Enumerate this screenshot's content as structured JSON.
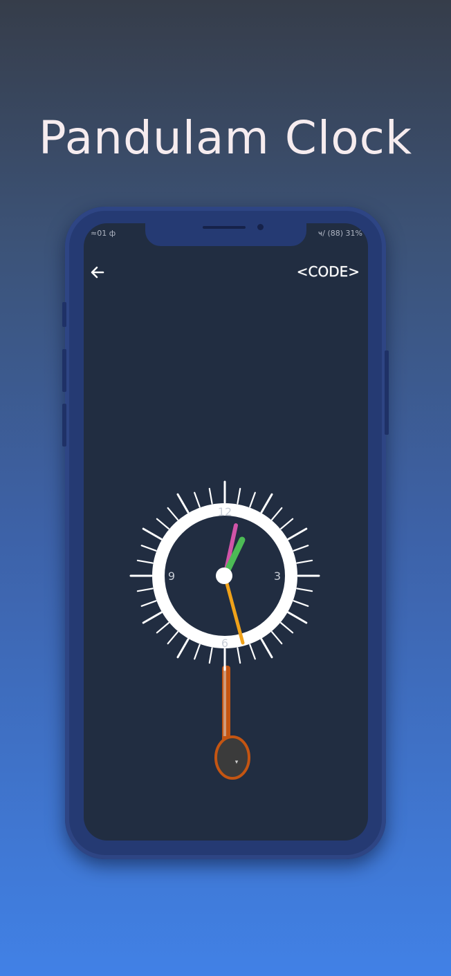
{
  "promo": {
    "title": "Pandulam Clock"
  },
  "status_bar": {
    "left": "≈01 ф",
    "right": "ҹ/ (88) 31%"
  },
  "toolbar": {
    "back_icon": "arrow-left-icon",
    "code_label": "<CODE>"
  },
  "clock": {
    "numerals": {
      "twelve": "12",
      "three": "3",
      "six": "6",
      "nine": "9"
    },
    "hands": {
      "hour_color": "#d054a8",
      "minute_color": "#4cbb55",
      "second_color": "#f0a21a"
    },
    "pendulum_color": "#c45512",
    "pendulum_bob_label": "▾"
  },
  "colors": {
    "background_top": "#363d4a",
    "background_bottom": "#4181e6",
    "phone_body": "#253a73",
    "screen": "#212d41",
    "dial_ring": "#ffffff"
  }
}
